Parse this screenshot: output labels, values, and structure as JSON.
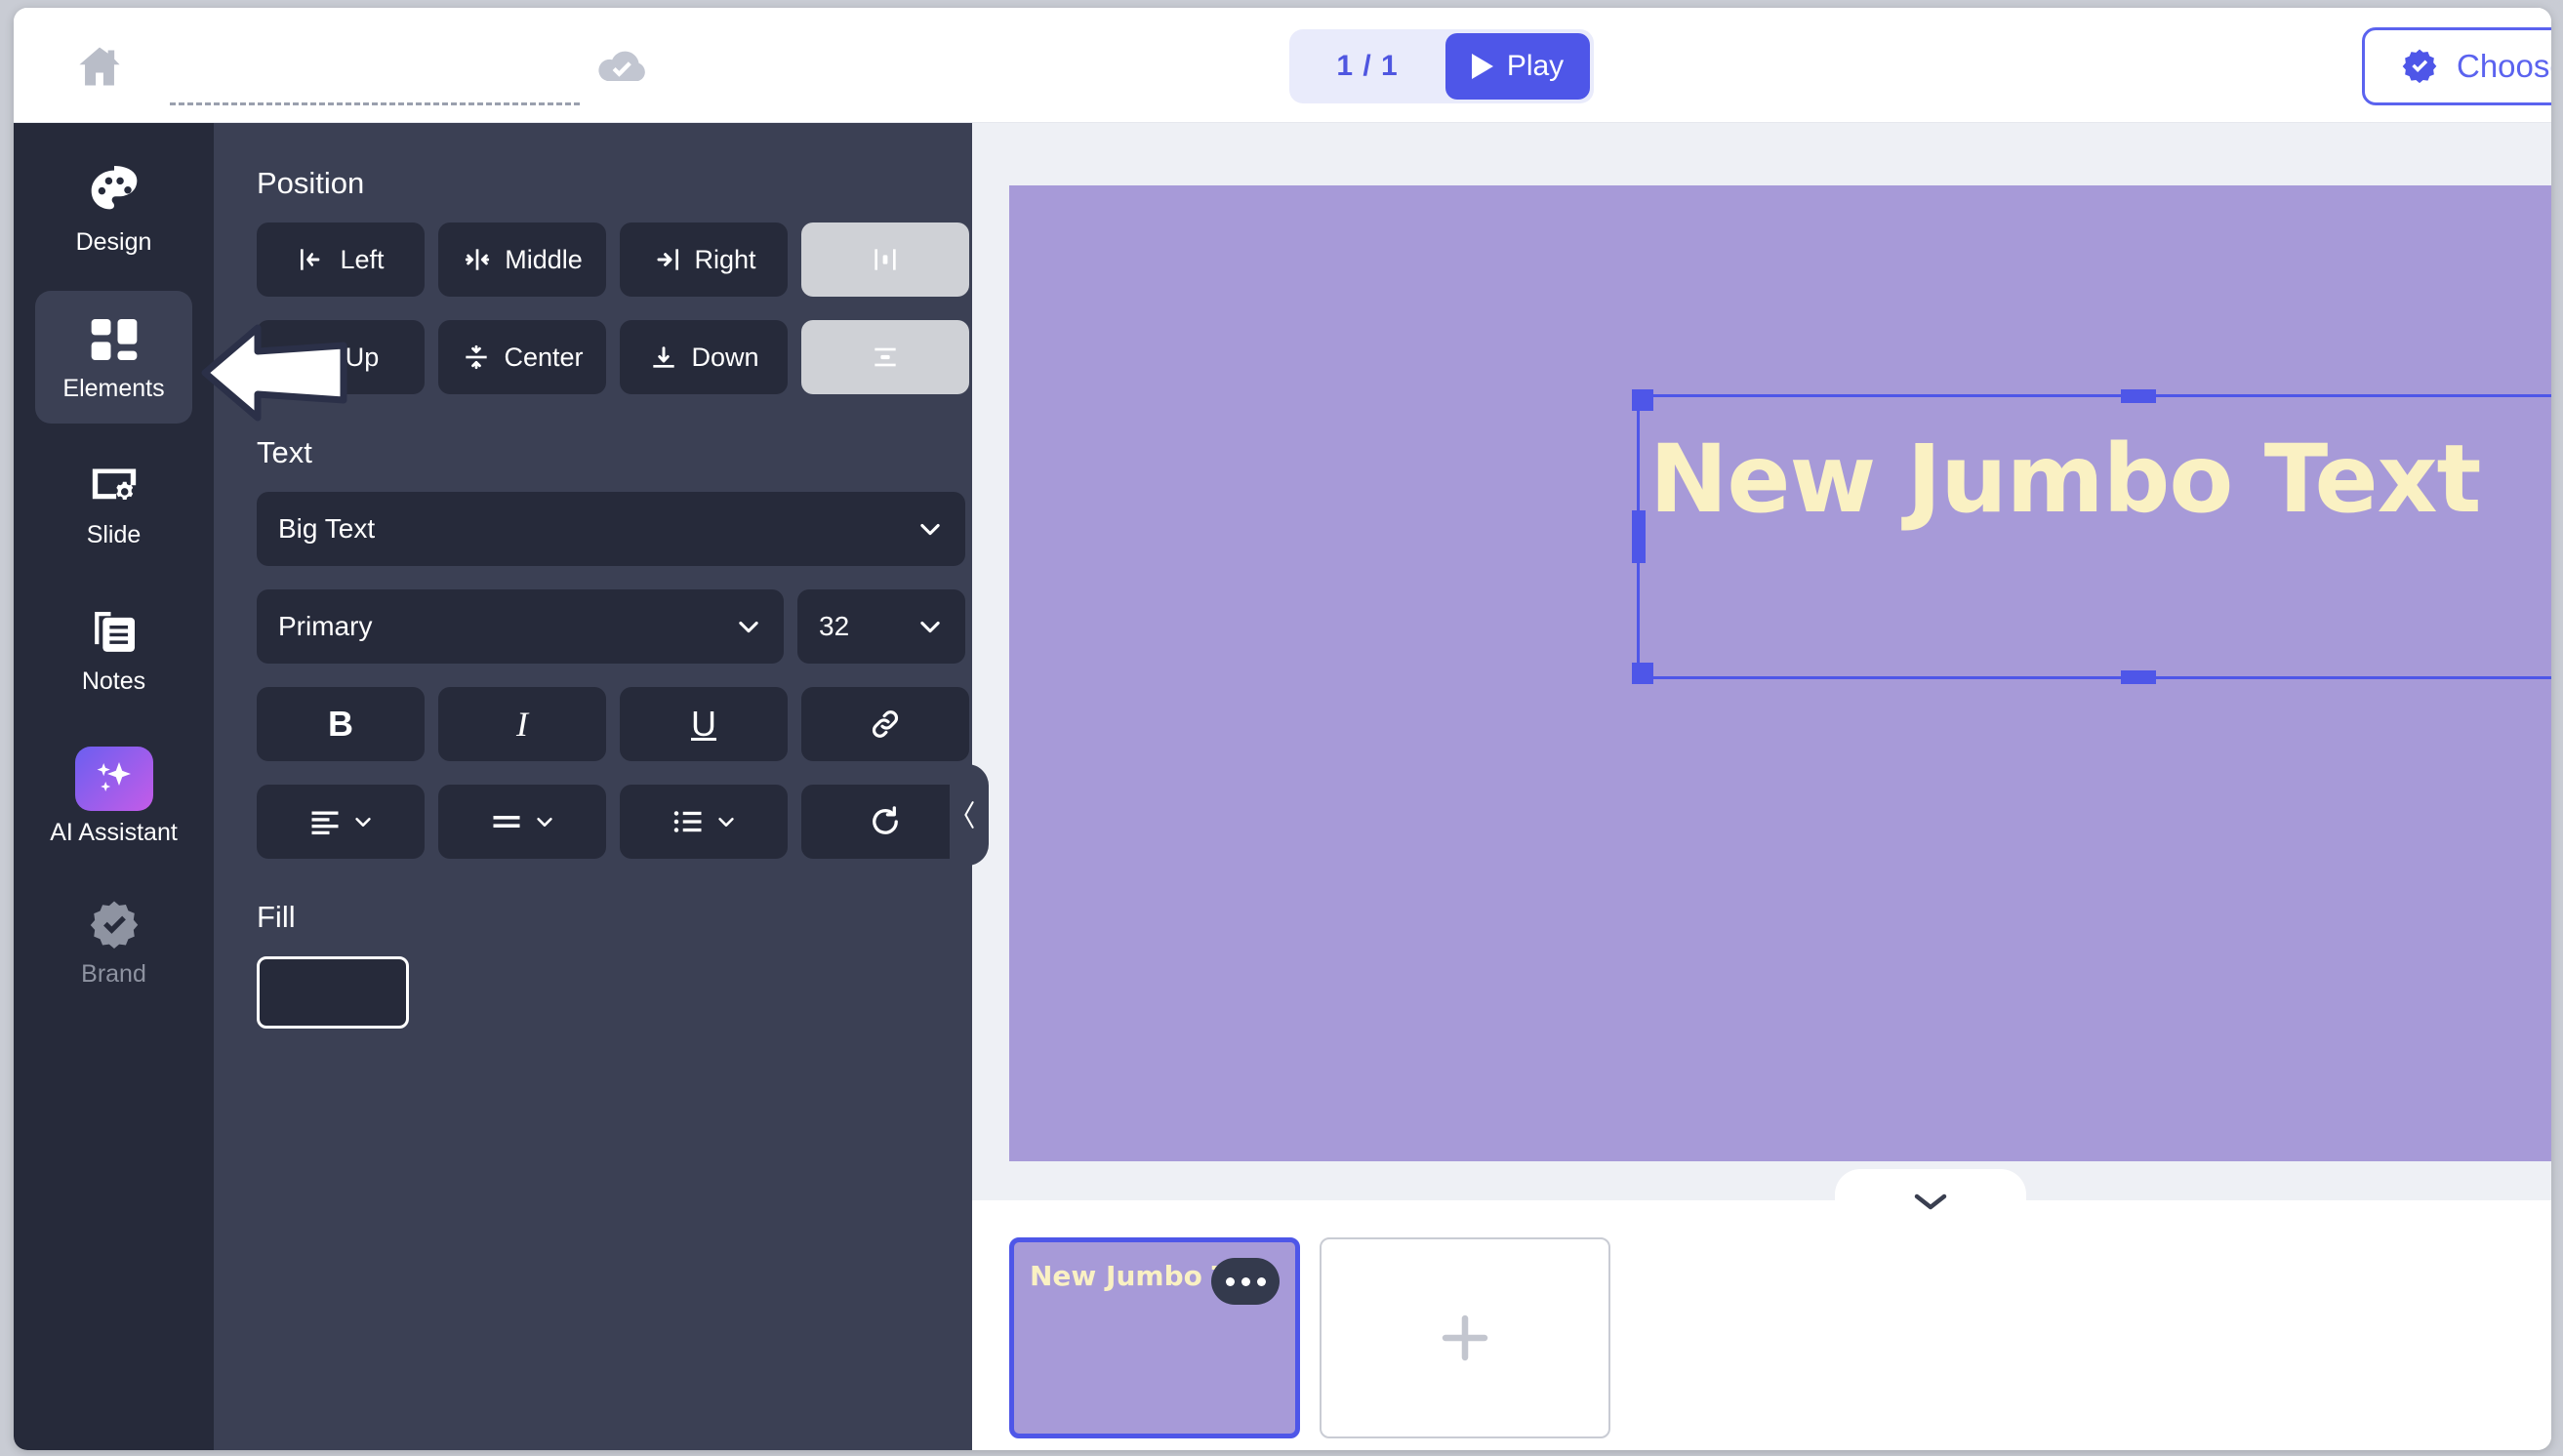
{
  "topbar": {
    "home_icon": "home-icon",
    "title_value": "",
    "title_placeholder": "",
    "save_icon": "cloud-check-icon",
    "page_counter": "1 / 1",
    "play_label": "Play",
    "play_icon": "play-triangle-icon",
    "choose_label": "Choose P",
    "choose_icon": "badge-check-icon"
  },
  "rail": {
    "items": [
      {
        "label": "Design",
        "icon": "palette-icon",
        "active": false
      },
      {
        "label": "Elements",
        "icon": "grid-icon",
        "active": true
      },
      {
        "label": "Slide",
        "icon": "slide-gear-icon",
        "active": false
      },
      {
        "label": "Notes",
        "icon": "notes-icon",
        "active": false
      },
      {
        "label": "AI Assistant",
        "icon": "sparkles-icon",
        "active": false
      },
      {
        "label": "Brand",
        "icon": "badge-check-icon",
        "active": false
      }
    ]
  },
  "panel": {
    "position": {
      "title": "Position",
      "buttons": [
        {
          "label": "Left",
          "icon": "align-left-icon"
        },
        {
          "label": "Middle",
          "icon": "align-center-h-icon"
        },
        {
          "label": "Right",
          "icon": "align-right-icon"
        },
        {
          "label": "",
          "icon": "distribute-h-icon"
        },
        {
          "label": "Up",
          "icon": "align-top-icon"
        },
        {
          "label": "Center",
          "icon": "align-center-v-icon"
        },
        {
          "label": "Down",
          "icon": "align-bottom-icon"
        },
        {
          "label": "",
          "icon": "distribute-v-icon"
        }
      ]
    },
    "text": {
      "title": "Text",
      "style_value": "Big Text",
      "color_value": "Primary",
      "size_value": "32",
      "bold_label": "B",
      "italic_label": "I",
      "underline_label": "U",
      "link_icon": "link-icon",
      "align_icon": "text-align-icon",
      "spacing_icon": "line-spacing-icon",
      "list_icon": "bullet-list-icon",
      "reset_icon": "reset-rotate-icon"
    },
    "fill": {
      "title": "Fill",
      "swatch_color": "#262a3a"
    },
    "collapse_icon": "chevron-left-icon"
  },
  "canvas": {
    "slide_background": "#a79ad8",
    "text_element": "New Jumbo Text",
    "text_color": "#faf1c3",
    "selection_color": "#4e56e8"
  },
  "tray": {
    "collapse_icon": "chevron-down-icon",
    "slides": [
      {
        "title": "New Jumbo Text",
        "menu_icon": "more-dots-icon",
        "selected": true
      }
    ],
    "add_icon": "plus-icon"
  },
  "annotation": {
    "arrow_icon": "pointer-arrow-left-icon"
  },
  "colors": {
    "accent": "#4e56e8",
    "panel_bg": "#3b4054",
    "rail_bg": "#262a3a",
    "canvas_bg": "#eef0f5"
  }
}
